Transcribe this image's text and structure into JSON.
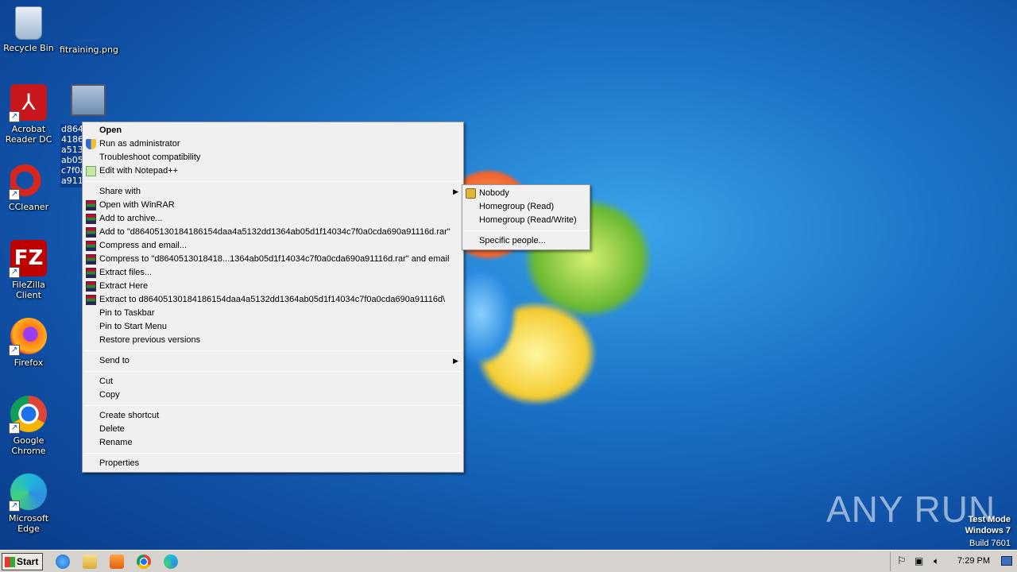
{
  "desktop": {
    "icons": [
      {
        "name": "recycle-bin",
        "label": "Recycle Bin"
      },
      {
        "name": "fitraining",
        "label": "fitraining.png"
      },
      {
        "name": "acrobat",
        "label": "Acrobat Reader DC"
      },
      {
        "name": "ccleaner",
        "label": "CCleaner"
      },
      {
        "name": "filezilla",
        "label": "FileZilla Client"
      },
      {
        "name": "firefox",
        "label": "Firefox"
      },
      {
        "name": "chrome",
        "label": "Google Chrome"
      },
      {
        "name": "edge",
        "label": "Microsoft Edge"
      }
    ],
    "selected_file_label": "d864 4186 a513 ab05 c7f0a a911"
  },
  "context_menu": {
    "items": [
      {
        "label": "Open"
      },
      {
        "label": "Run as administrator",
        "icon": "uac-shield-icon"
      },
      {
        "label": "Troubleshoot compatibility"
      },
      {
        "label": "Edit with Notepad++",
        "icon": "notepadpp-icon"
      },
      {
        "label": "Share with"
      },
      {
        "label": "Open with WinRAR",
        "icon": "winrar-icon"
      },
      {
        "label": "Add to archive...",
        "icon": "winrar-icon"
      },
      {
        "label": "Add to \"d86405130184186154daa4a5132dd1364ab05d1f14034c7f0a0cda690a91116d.rar\"",
        "icon": "winrar-icon"
      },
      {
        "label": "Compress and email...",
        "icon": "winrar-icon"
      },
      {
        "label": "Compress to \"d8640513018418...1364ab05d1f14034c7f0a0cda690a91116d.rar\" and email",
        "icon": "winrar-icon"
      },
      {
        "label": "Extract files...",
        "icon": "winrar-icon"
      },
      {
        "label": "Extract Here",
        "icon": "winrar-icon"
      },
      {
        "label": "Extract to d86405130184186154daa4a5132dd1364ab05d1f14034c7f0a0cda690a91116d\\",
        "icon": "winrar-icon"
      },
      {
        "label": "Pin to Taskbar"
      },
      {
        "label": "Pin to Start Menu"
      },
      {
        "label": "Restore previous versions"
      },
      {
        "label": "Send to"
      },
      {
        "label": "Cut"
      },
      {
        "label": "Copy"
      },
      {
        "label": "Create shortcut"
      },
      {
        "label": "Delete"
      },
      {
        "label": "Rename"
      },
      {
        "label": "Properties"
      }
    ]
  },
  "submenu": {
    "items": [
      {
        "label": "Nobody",
        "icon": "lock-icon"
      },
      {
        "label": "Homegroup (Read)"
      },
      {
        "label": "Homegroup (Read/Write)"
      },
      {
        "label": "Specific people..."
      }
    ]
  },
  "taskbar": {
    "start_label": "Start",
    "clock": "7:29 PM"
  },
  "watermark": {
    "line1": "Test Mode",
    "line2": "Windows 7",
    "line3": "Build 7601",
    "brand": "ANY RUN"
  }
}
